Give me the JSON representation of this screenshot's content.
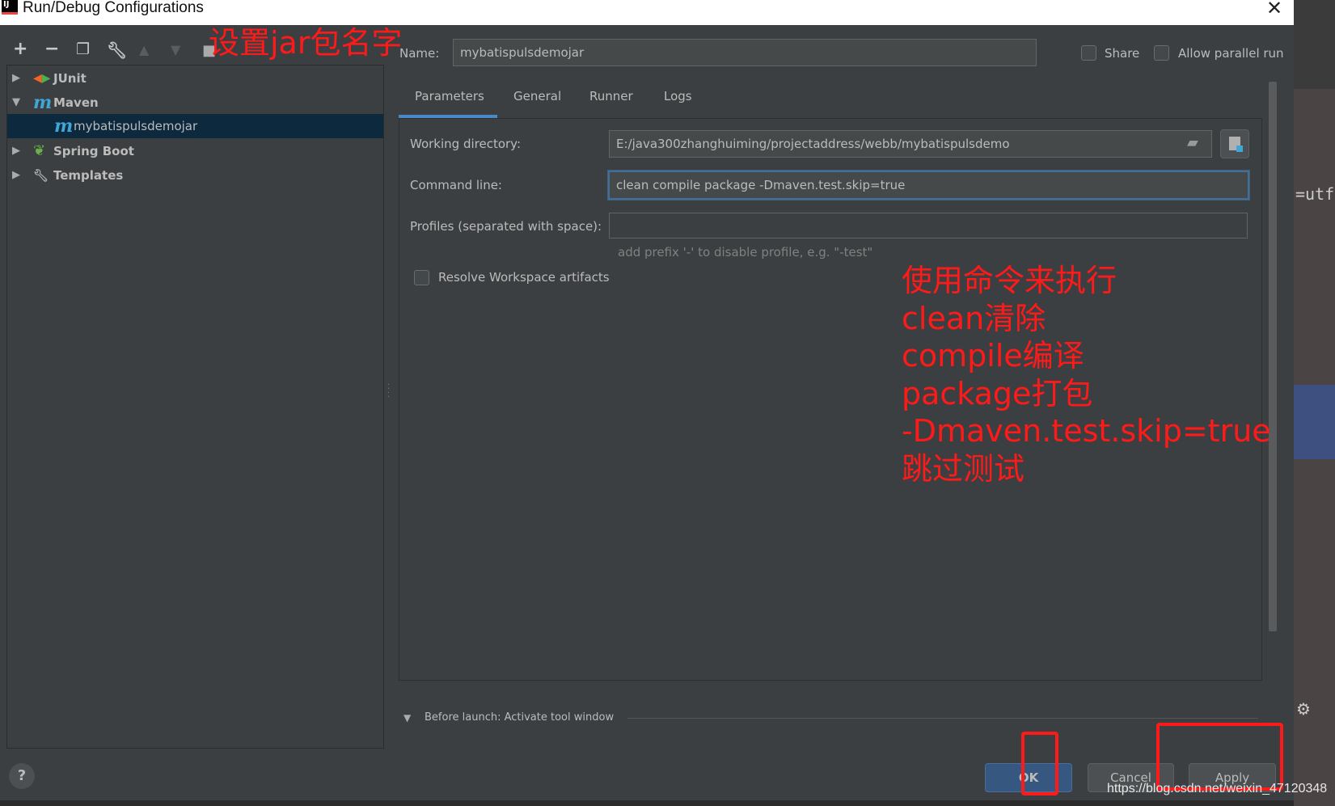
{
  "window": {
    "title": "Run/Debug Configurations",
    "close_icon": "close-icon",
    "app_icon": "intellij-icon",
    "app_icon_text": "IJ"
  },
  "toolbar": {
    "icons": [
      "add-icon",
      "remove-icon",
      "copy-icon",
      "wrench-icon",
      "move-up-icon",
      "move-down-icon",
      "folder-icon",
      "sort-icon"
    ]
  },
  "tree": {
    "items": [
      {
        "label": "JUnit",
        "icon": "junit-icon",
        "expanded": false
      },
      {
        "label": "Maven",
        "icon": "maven-icon",
        "expanded": true
      },
      {
        "label": "mybatispulsdemojar",
        "icon": "maven-icon",
        "selected": true
      },
      {
        "label": "Spring Boot",
        "icon": "spring-boot-icon",
        "expanded": false
      },
      {
        "label": "Templates",
        "icon": "wrench-icon",
        "expanded": false
      }
    ],
    "maven_glyph": "m"
  },
  "form": {
    "name_label": "Name:",
    "name_value": "mybatispulsdemojar",
    "share_label": "Share",
    "allow_parallel_label": "Allow parallel run",
    "tabs": [
      "Parameters",
      "General",
      "Runner",
      "Logs"
    ],
    "active_tab": "Parameters",
    "working_dir_label": "Working directory:",
    "working_dir_value": "E:/java300zhanghuiming/projectaddress/webb/mybatispulsdemo",
    "command_label": "Command line:",
    "command_value": "clean compile package -Dmaven.test.skip=true",
    "profiles_label": "Profiles (separated with space):",
    "profiles_value": "",
    "profiles_hint": "add prefix '-' to disable profile, e.g. \"-test\"",
    "resolve_label": "Resolve Workspace artifacts",
    "before_launch": "Before launch: Activate tool window"
  },
  "buttons": {
    "ok": "OK",
    "cancel": "Cancel",
    "apply": "Apply",
    "help": "?"
  },
  "annotations": {
    "top": "设置jar包名字",
    "lines": [
      "使用命令来执行",
      "clean清除",
      "compile编译",
      "package打包",
      "-Dmaven.test.skip=true",
      "跳过测试"
    ]
  },
  "background": {
    "code_fragment": "=utf"
  },
  "watermark": "https://blog.csdn.net/weixin_47120348",
  "colors": {
    "accent": "#4a88c7",
    "annotation": "#ff1a1a",
    "selection": "#0d293e",
    "ok_button": "#365880"
  }
}
